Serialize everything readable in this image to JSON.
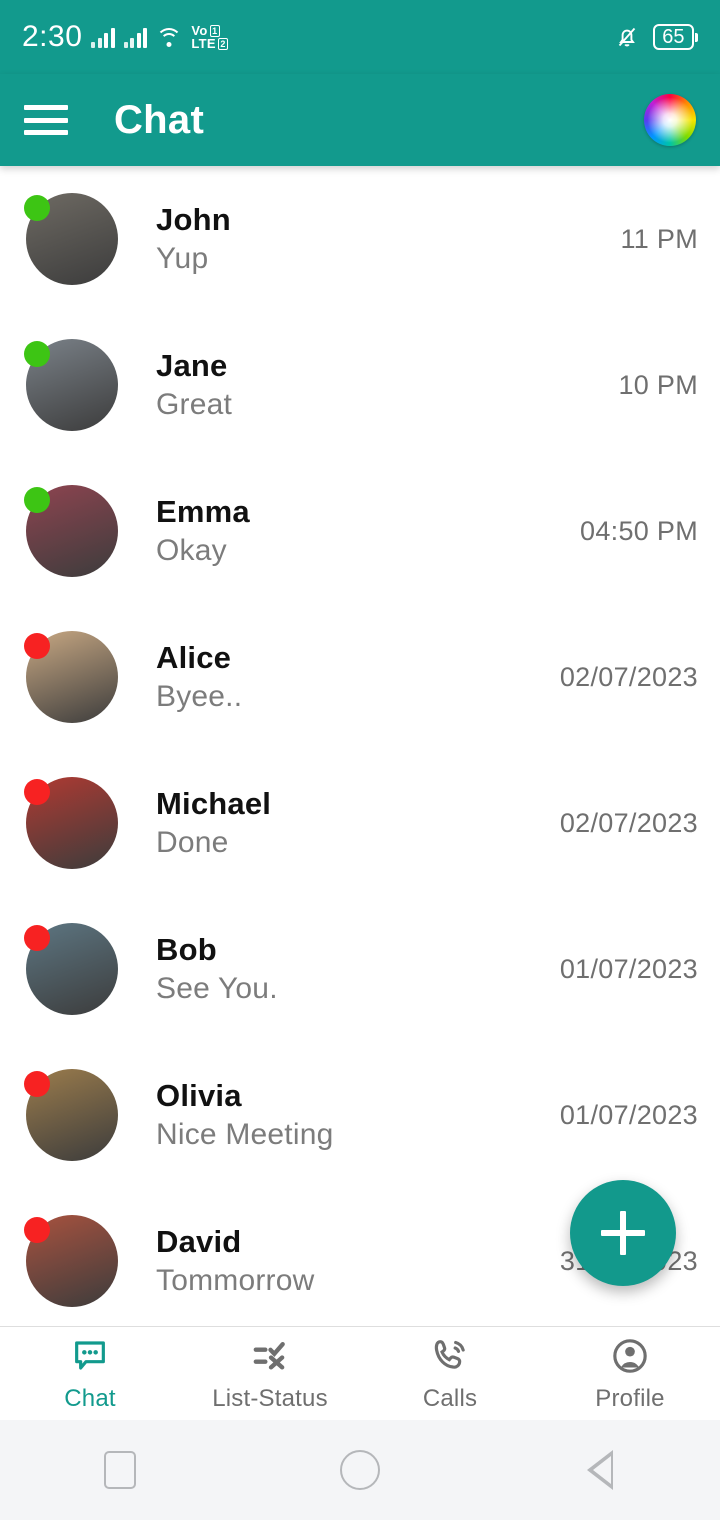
{
  "theme": {
    "accent": "#129a8d",
    "online_color": "#3dc514",
    "offline_color": "#f72222",
    "name_color": "#111111",
    "muted_color": "#7c7c7c",
    "time_color": "#6f6f6f"
  },
  "status_bar": {
    "clock": "2:30",
    "network_label_top": "Vo",
    "network_label_bottom": "LTE",
    "sim1": "1",
    "sim2": "2",
    "battery_level": "65",
    "icons": [
      "signal-bars-icon",
      "signal-bars-icon",
      "wifi-icon",
      "volte-icon",
      "vibrate-icon",
      "battery-icon"
    ]
  },
  "app_bar": {
    "title": "Chat",
    "menu_icon": "hamburger-menu-icon",
    "theme_icon": "color-wheel-icon"
  },
  "chats": [
    {
      "name": "John",
      "message": "Yup",
      "time": "11 PM",
      "status": "online",
      "avatar_bg": "#6e6a63"
    },
    {
      "name": "Jane",
      "message": "Great",
      "time": "10 PM",
      "status": "online",
      "avatar_bg": "#7a8188"
    },
    {
      "name": "Emma",
      "message": "Okay",
      "time": "04:50 PM",
      "status": "online",
      "avatar_bg": "#8e4450"
    },
    {
      "name": "Alice",
      "message": "Byee..",
      "time": "02/07/2023",
      "status": "offline",
      "avatar_bg": "#c8a883"
    },
    {
      "name": "Michael",
      "message": "Done",
      "time": "02/07/2023",
      "status": "offline",
      "avatar_bg": "#b03a32"
    },
    {
      "name": "Bob",
      "message": "See You.",
      "time": "01/07/2023",
      "status": "offline",
      "avatar_bg": "#5d7682"
    },
    {
      "name": "Olivia",
      "message": "Nice Meeting",
      "time": "01/07/2023",
      "status": "offline",
      "avatar_bg": "#9b7c4c"
    },
    {
      "name": "David",
      "message": "Tommorrow",
      "time": "31/06/2023",
      "status": "offline",
      "avatar_bg": "#a8523f"
    }
  ],
  "fab": {
    "label": "+",
    "icon": "plus-icon"
  },
  "bottom_nav": [
    {
      "label": "Chat",
      "icon": "chat-bubble-icon",
      "active": true
    },
    {
      "label": "List-Status",
      "icon": "checklist-icon",
      "active": false
    },
    {
      "label": "Calls",
      "icon": "phone-call-icon",
      "active": false
    },
    {
      "label": "Profile",
      "icon": "person-circle-icon",
      "active": false
    }
  ],
  "android_nav": [
    {
      "icon": "recents-square-icon"
    },
    {
      "icon": "home-circle-icon"
    },
    {
      "icon": "back-triangle-icon"
    }
  ]
}
